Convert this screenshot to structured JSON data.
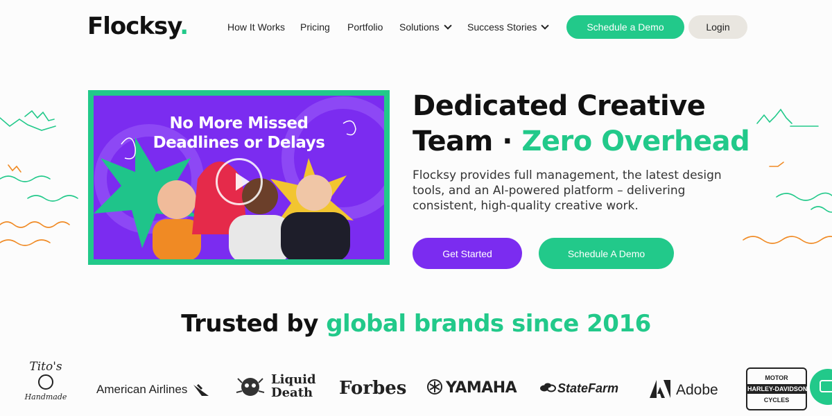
{
  "header": {
    "logo_text": "Flocksy",
    "logo_dot": ".",
    "nav": [
      {
        "label": "How It Works"
      },
      {
        "label": "Pricing"
      },
      {
        "label": "Portfolio"
      },
      {
        "label": "Solutions"
      },
      {
        "label": "Success Stories"
      }
    ],
    "demo_button": "Schedule a Demo",
    "login_button": "Login"
  },
  "hero": {
    "video_title_line1": "No More Missed",
    "video_title_line2": "Deadlines or Delays",
    "heading_line1": "Dedicated Creative",
    "heading_line2_a": "Team · ",
    "heading_line2_b": "Zero Overhead",
    "subtext": "Flocksy provides full management, the latest design tools, and an AI-powered platform – delivering consistent, high-quality creative work.",
    "get_started": "Get Started",
    "schedule_demo": "Schedule A Demo"
  },
  "trusted": {
    "text_a": "Trusted by ",
    "text_b": "global brands since 2016"
  },
  "brands": {
    "titos": "Tito's",
    "titos_sub": "Handmade",
    "american": "American Airlines",
    "liquid1": "Liquid",
    "liquid2": "Death",
    "forbes": "Forbes",
    "yamaha": "YAMAHA",
    "statefarm": "StateFarm",
    "adobe": "Adobe",
    "hd1": "MOTOR",
    "hd2": "HARLEY-DAVIDSON",
    "hd3": "CYCLES"
  },
  "colors": {
    "accent_green": "#22c98a",
    "accent_purple": "#7b2cf0"
  }
}
